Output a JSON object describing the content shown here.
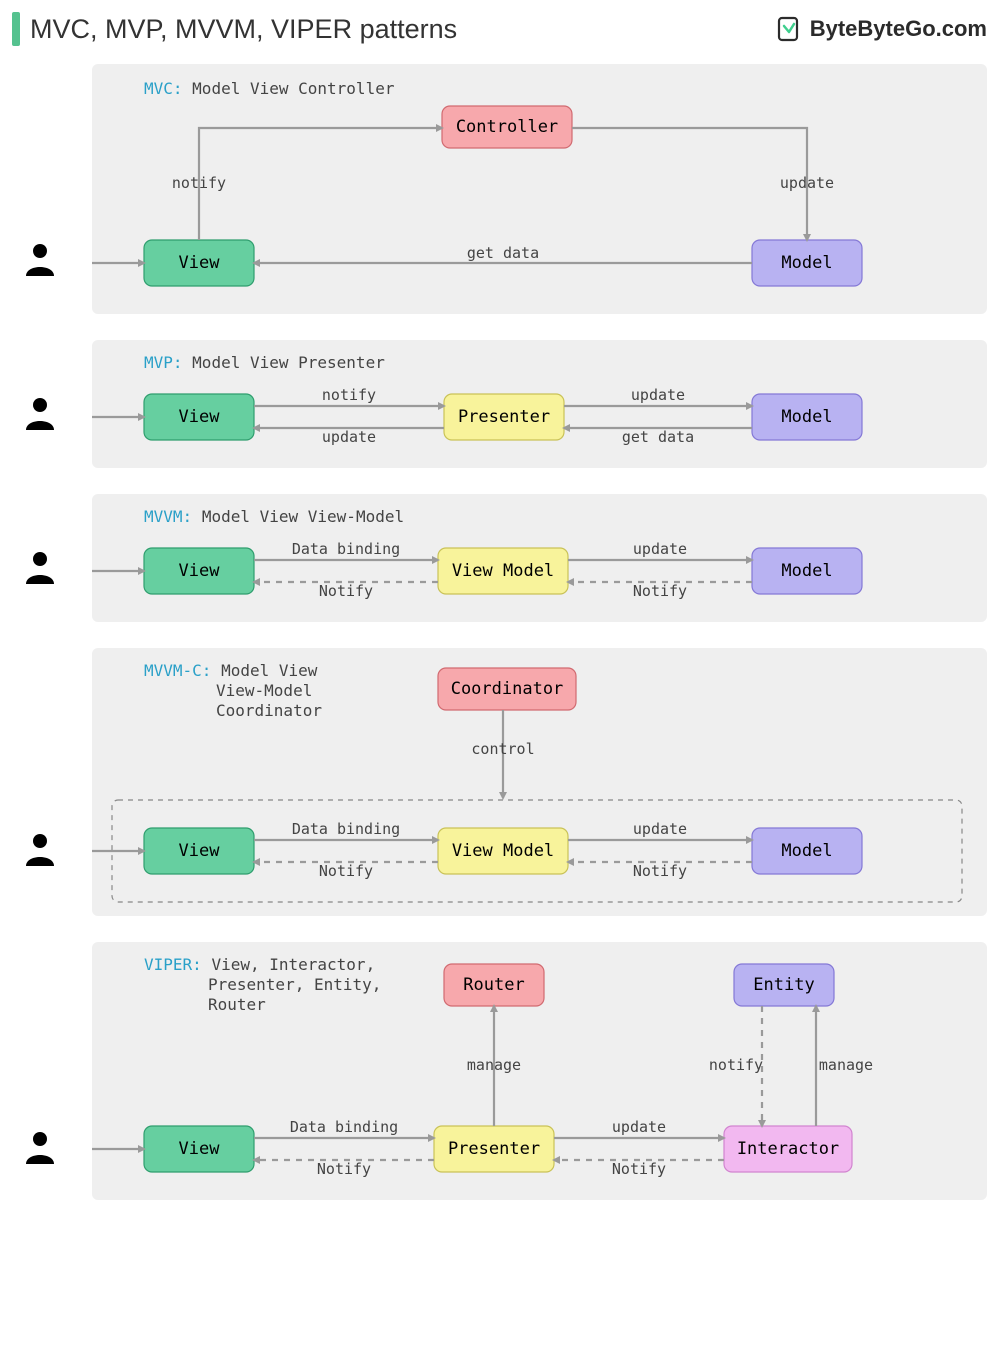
{
  "title": "MVC, MVP, MVVM, VIPER patterns",
  "brand": "ByteByteGo.com",
  "colors": {
    "view": {
      "fill": "#66cfa0",
      "stroke": "#2f9e6e"
    },
    "controller": {
      "fill": "#f7a8ac",
      "stroke": "#d16a70"
    },
    "model": {
      "fill": "#b8b2f2",
      "stroke": "#8478d6"
    },
    "presenter": {
      "fill": "#f8f39b",
      "stroke": "#c9c257"
    },
    "interactor": {
      "fill": "#f2b8f0",
      "stroke": "#d184cf"
    }
  },
  "mvc": {
    "key": "MVC:",
    "name": "Model View Controller",
    "nodes": {
      "view": "View",
      "controller": "Controller",
      "model": "Model"
    },
    "labels": {
      "notify": "notify",
      "update": "update",
      "get": "get data"
    }
  },
  "mvp": {
    "key": "MVP:",
    "name": "Model View Presenter",
    "nodes": {
      "view": "View",
      "presenter": "Presenter",
      "model": "Model"
    },
    "labels": {
      "notify": "notify",
      "update1": "update",
      "update2": "update",
      "get": "get data"
    }
  },
  "mvvm": {
    "key": "MVVM:",
    "name": "Model View View-Model",
    "nodes": {
      "view": "View",
      "vm": "View Model",
      "model": "Model"
    },
    "labels": {
      "bind": "Data binding",
      "notify1": "Notify",
      "update": "update",
      "notify2": "Notify"
    }
  },
  "mvvmc": {
    "key": "MVVM-C:",
    "name1": "Model View",
    "name2": "View-Model",
    "name3": "Coordinator",
    "nodes": {
      "view": "View",
      "vm": "View Model",
      "model": "Model",
      "coordinator": "Coordinator"
    },
    "labels": {
      "control": "control",
      "bind": "Data binding",
      "notify1": "Notify",
      "update": "update",
      "notify2": "Notify"
    }
  },
  "viper": {
    "key": "VIPER:",
    "name1": "View, Interactor,",
    "name2": "Presenter, Entity,",
    "name3": "Router",
    "nodes": {
      "view": "View",
      "presenter": "Presenter",
      "router": "Router",
      "entity": "Entity",
      "interactor": "Interactor"
    },
    "labels": {
      "manage1": "manage",
      "bind": "Data binding",
      "notify1": "Notify",
      "update": "update",
      "notify2": "Notify",
      "notify3": "notify",
      "manage2": "manage"
    }
  }
}
